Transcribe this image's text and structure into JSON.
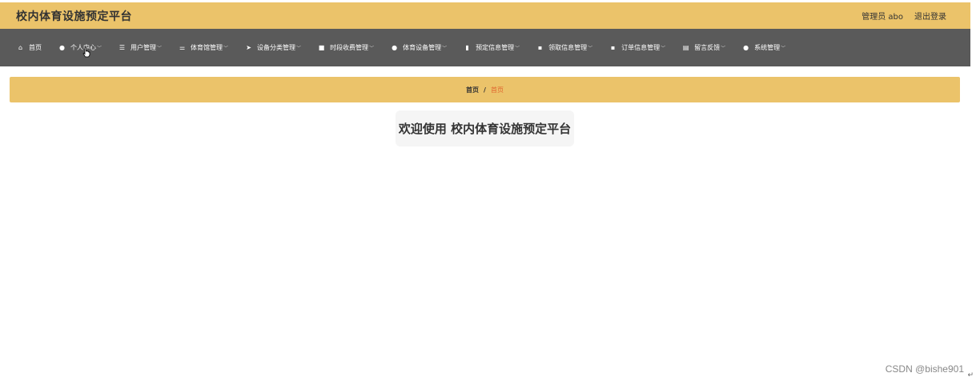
{
  "header": {
    "title": "校内体育设施预定平台",
    "user_label": "管理员 abo",
    "logout_label": "退出登录"
  },
  "nav": {
    "items": [
      {
        "label": "首页",
        "icon": "home-icon",
        "glyph": "⌂",
        "dropdown": false
      },
      {
        "label": "个人中心",
        "icon": "user-icon",
        "glyph": "●",
        "dropdown": true
      },
      {
        "label": "用户管理",
        "icon": "list-icon",
        "glyph": "☰",
        "dropdown": true
      },
      {
        "label": "体育馆管理",
        "icon": "sliders-icon",
        "glyph": "⚌",
        "dropdown": true
      },
      {
        "label": "设备分类管理",
        "icon": "send-icon",
        "glyph": "➤",
        "dropdown": true
      },
      {
        "label": "时段收费管理",
        "icon": "film-icon",
        "glyph": "■",
        "dropdown": true
      },
      {
        "label": "体育设备管理",
        "icon": "map-pin-icon",
        "glyph": "●",
        "dropdown": true
      },
      {
        "label": "预定信息管理",
        "icon": "bar-chart-icon",
        "glyph": "▮",
        "dropdown": true
      },
      {
        "label": "领取信息管理",
        "icon": "grid-icon",
        "glyph": "▪",
        "dropdown": true
      },
      {
        "label": "订单信息管理",
        "icon": "grid-icon",
        "glyph": "▪",
        "dropdown": true
      },
      {
        "label": "留言反馈",
        "icon": "clipboard-icon",
        "glyph": "▤",
        "dropdown": true
      },
      {
        "label": "系统管理",
        "icon": "user-icon",
        "glyph": "●",
        "dropdown": true
      }
    ]
  },
  "breadcrumb": {
    "home": "首页",
    "separator": "/",
    "current": "首页"
  },
  "main": {
    "welcome": "欢迎使用 校内体育设施预定平台"
  },
  "watermark": "CSDN @bishe901",
  "colors": {
    "accent": "#ebc36a",
    "nav_bg": "#5a5a5a",
    "crumb_current": "#e0662e"
  }
}
